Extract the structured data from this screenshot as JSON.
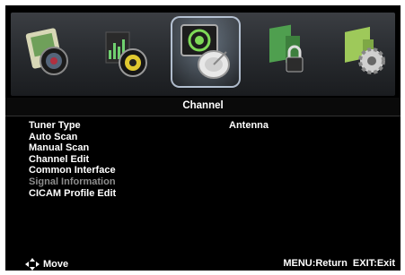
{
  "header": {
    "title": "Channel"
  },
  "icons": [
    {
      "name": "picture-icon"
    },
    {
      "name": "sound-icon"
    },
    {
      "name": "channel-icon",
      "active": true
    },
    {
      "name": "lock-icon"
    },
    {
      "name": "setup-icon"
    }
  ],
  "menu": {
    "items": [
      {
        "label": "Tuner Type",
        "value": "Antenna"
      },
      {
        "label": "Auto Scan"
      },
      {
        "label": "Manual Scan"
      },
      {
        "label": "Channel Edit"
      },
      {
        "label": "Common Interface"
      },
      {
        "label": "Signal Information",
        "disabled": true
      },
      {
        "label": "CICAM Profile Edit"
      }
    ]
  },
  "footer": {
    "move_label": "Move",
    "keys_label": "MENU:Return  EXIT:Exit"
  },
  "colors": {
    "background": "#000000",
    "text": "#ffffff",
    "disabled_text": "#8c8c8c"
  }
}
